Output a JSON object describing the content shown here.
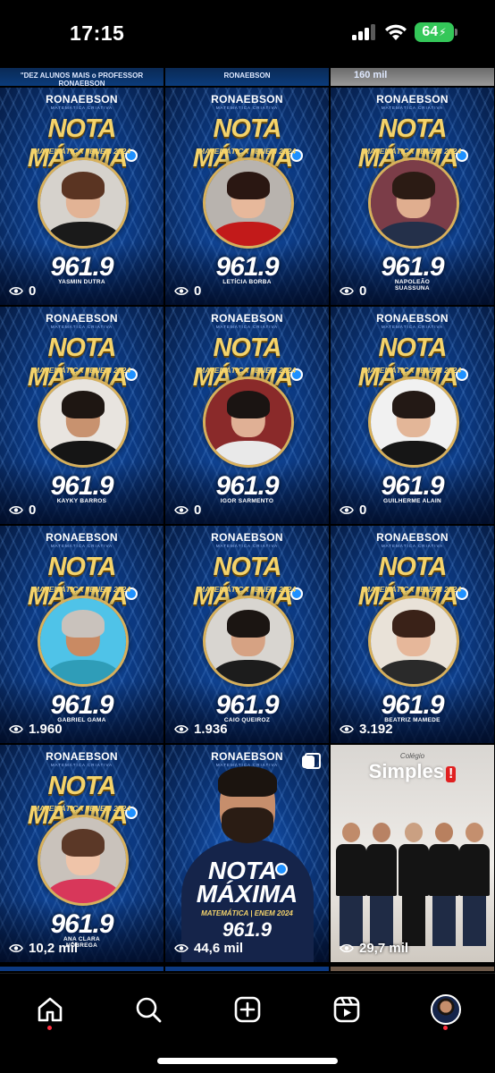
{
  "status_bar": {
    "time": "17:15",
    "battery": "64"
  },
  "top_row": [
    {
      "text": "\"DEZ ALUNOS MAIS o PROFESSOR RONAEBSON"
    },
    {
      "text": "RONAEBSON"
    },
    {
      "text": "160 mil"
    }
  ],
  "brand": {
    "name": "RONAEBSON",
    "tagline": "MATEMÁTICA CRIATIVA"
  },
  "headline": {
    "title": "NOTA MÁXIMA",
    "subtitle": "MATEMÁTICA | ENEM 2024"
  },
  "posts": [
    {
      "score": "961.9",
      "name": "YASMIN DUTRA",
      "views": "0",
      "photo": {
        "bg": "#d6d2cc",
        "skin": "#e2b395",
        "hair": "#5a3422",
        "shirt": "#1a1a1a"
      }
    },
    {
      "score": "961.9",
      "name": "LETÍCIA BORBA",
      "views": "0",
      "photo": {
        "bg": "#b8b3ae",
        "skin": "#e7b89b",
        "hair": "#2a1712",
        "shirt": "#c21a1a"
      }
    },
    {
      "score": "961.9",
      "name": "NAPOLEÃO SUASSUNA",
      "views": "0",
      "photo": {
        "bg": "#7b3d48",
        "skin": "#e0ae8f",
        "hair": "#2b1b14",
        "shirt": "#24304a"
      }
    },
    {
      "score": "961.9",
      "name": "KAYKY BARROS",
      "views": "0",
      "photo": {
        "bg": "#e8e4df",
        "skin": "#c8926f",
        "hair": "#1e1612",
        "shirt": "#151515"
      }
    },
    {
      "score": "961.9",
      "name": "IGOR SARMENTO",
      "views": "0",
      "photo": {
        "bg": "#8a2a2a",
        "skin": "#e0b095",
        "hair": "#1a1412",
        "shirt": "#e9e9e9"
      }
    },
    {
      "score": "961.9",
      "name": "GUILHERME ALAIN",
      "views": "0",
      "photo": {
        "bg": "#f1f1f1",
        "skin": "#e3b698",
        "hair": "#231915",
        "shirt": "#161616"
      }
    },
    {
      "score": "961.9",
      "name": "GABRIEL GAMA",
      "views": "1.960",
      "photo": {
        "bg": "#4fc3e8",
        "skin": "#c98a63",
        "hair": "#c9c2bc",
        "shirt": "#2f9db8"
      }
    },
    {
      "score": "961.9",
      "name": "CAIO QUEIROZ",
      "views": "1.936",
      "photo": {
        "bg": "#d8d5d0",
        "skin": "#d6a283",
        "hair": "#1b1512",
        "shirt": "#1c1c1c"
      }
    },
    {
      "score": "961.9",
      "name": "BEATRIZ MAMEDE",
      "views": "3.192",
      "photo": {
        "bg": "#e9e2d8",
        "skin": "#e6b79a",
        "hair": "#3a2218",
        "shirt": "#2a2a2a"
      }
    },
    {
      "score": "961.9",
      "name": "ANA CLARA NÓBREGA",
      "views": "10,2 mil",
      "photo": {
        "bg": "#c9c2bb",
        "skin": "#efc4a9",
        "hair": "#5b3827",
        "shirt": "#d8375a"
      }
    }
  ],
  "feature_post": {
    "title_top": "NOTA",
    "title_bottom": "MÁXIMA",
    "subtitle": "MATEMÁTICA | ENEM 2024",
    "score": "961.9",
    "views": "44,6 mil",
    "icon": "carousel-icon"
  },
  "simples_post": {
    "small": "Colégio",
    "brand": "Simples",
    "mark": "!",
    "views": "29,7 mil",
    "accent": "#e02020"
  },
  "tab_bar": {
    "icons": [
      "home-icon",
      "search-icon",
      "create-icon",
      "reels-icon",
      "profile-avatar"
    ],
    "active": "home-icon",
    "notification_color": "#ff3040"
  }
}
